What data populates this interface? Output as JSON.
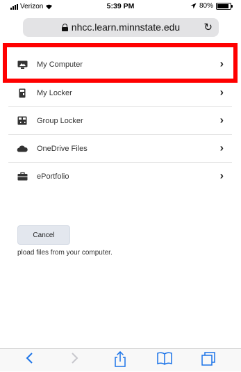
{
  "status": {
    "carrier": "Verizon",
    "time": "5:39 PM",
    "battery": "80%",
    "battery_level": 0.8
  },
  "browser": {
    "url": "nhcc.learn.minnstate.edu"
  },
  "file_sources": [
    {
      "label": "My Computer",
      "icon": "monitor-icon"
    },
    {
      "label": "My Locker",
      "icon": "locker-icon"
    },
    {
      "label": "Group Locker",
      "icon": "group-locker-icon"
    },
    {
      "label": "OneDrive Files",
      "icon": "cloud-icon"
    },
    {
      "label": "ePortfolio",
      "icon": "briefcase-icon"
    }
  ],
  "actions": {
    "cancel_label": "Cancel"
  },
  "helper_text": "pload files from your computer.",
  "colors": {
    "highlight": "#ff0000",
    "toolbar_icon": "#1a73e8"
  }
}
